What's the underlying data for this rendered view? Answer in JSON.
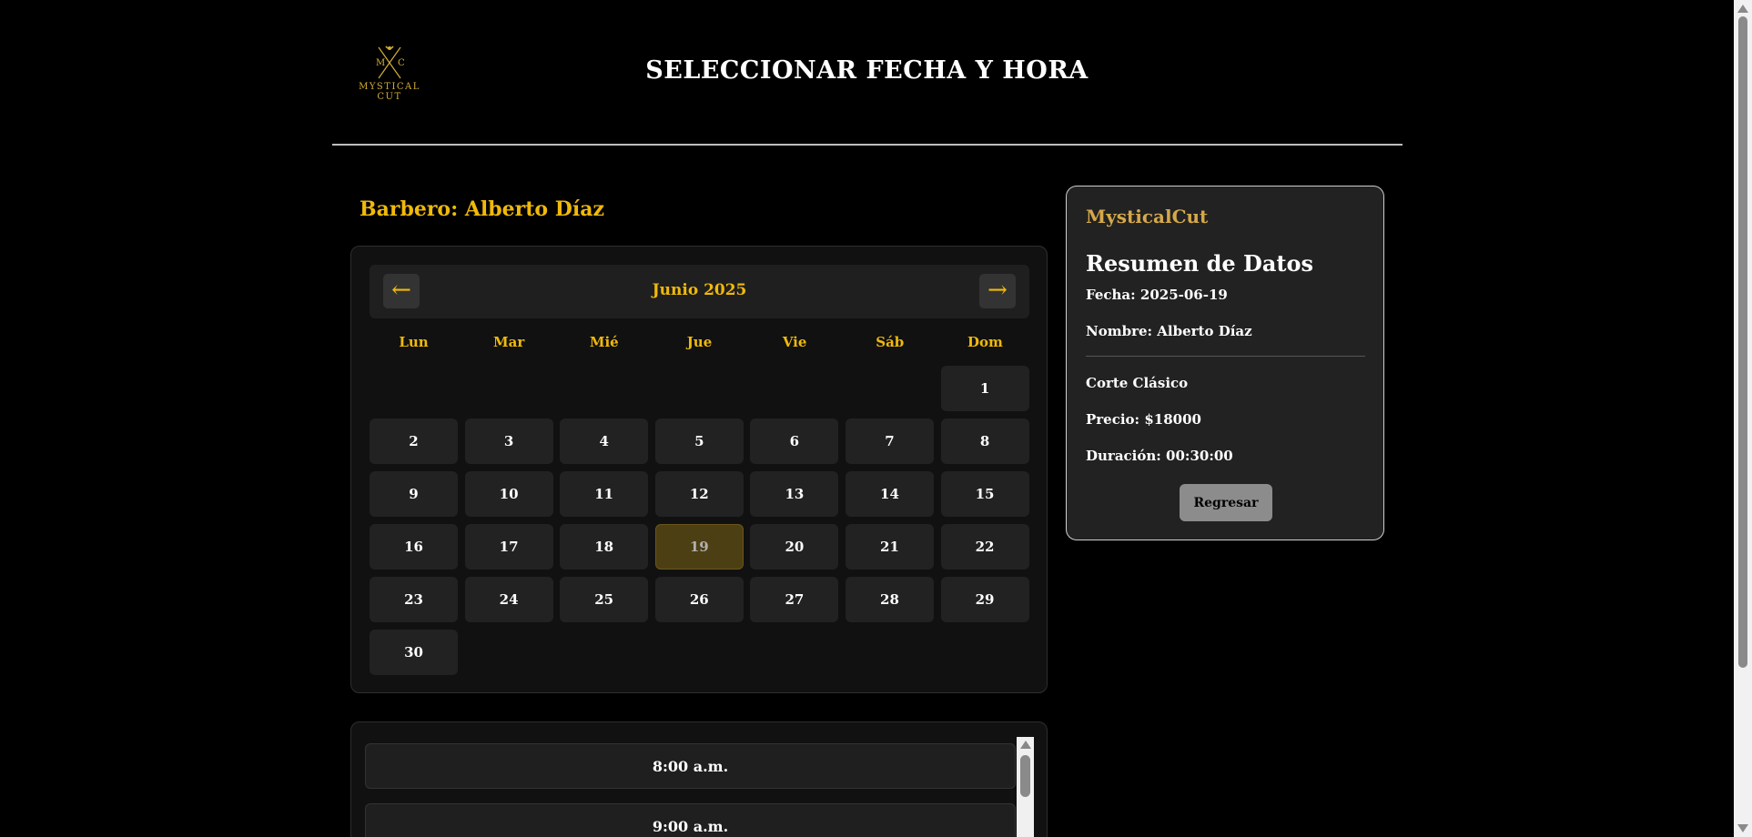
{
  "header": {
    "logo": {
      "initials_left": "M",
      "initials_right": "C",
      "line1": "MYSTICAL",
      "line2": "CUT",
      "icon": "crossed-scissors-icon",
      "color": "#d4af37"
    },
    "title": "SELECCIONAR FECHA Y HORA"
  },
  "barber": {
    "label": "Barbero: Alberto Díaz"
  },
  "calendar": {
    "prev_icon": "←",
    "next_icon": "→",
    "month": "Junio 2025",
    "weekdays": [
      "Lun",
      "Mar",
      "Mié",
      "Jue",
      "Vie",
      "Sáb",
      "Dom"
    ],
    "leading_empty": 6,
    "days": [
      "1",
      "2",
      "3",
      "4",
      "5",
      "6",
      "7",
      "8",
      "9",
      "10",
      "11",
      "12",
      "13",
      "14",
      "15",
      "16",
      "17",
      "18",
      "19",
      "20",
      "21",
      "22",
      "23",
      "24",
      "25",
      "26",
      "27",
      "28",
      "29",
      "30"
    ],
    "selected_day": "19",
    "accent": "#f0b90b"
  },
  "times": {
    "slots": [
      "8:00 a.m.",
      "9:00 a.m."
    ]
  },
  "summary": {
    "brand": "MysticalCut",
    "title": "Resumen de Datos",
    "fecha": "Fecha: 2025-06-19",
    "nombre": "Nombre: Alberto Díaz",
    "servicio": "Corte Clásico",
    "precio": "Precio: $18000",
    "duracion": "Duración: 00:30:00",
    "back_label": "Regresar"
  }
}
